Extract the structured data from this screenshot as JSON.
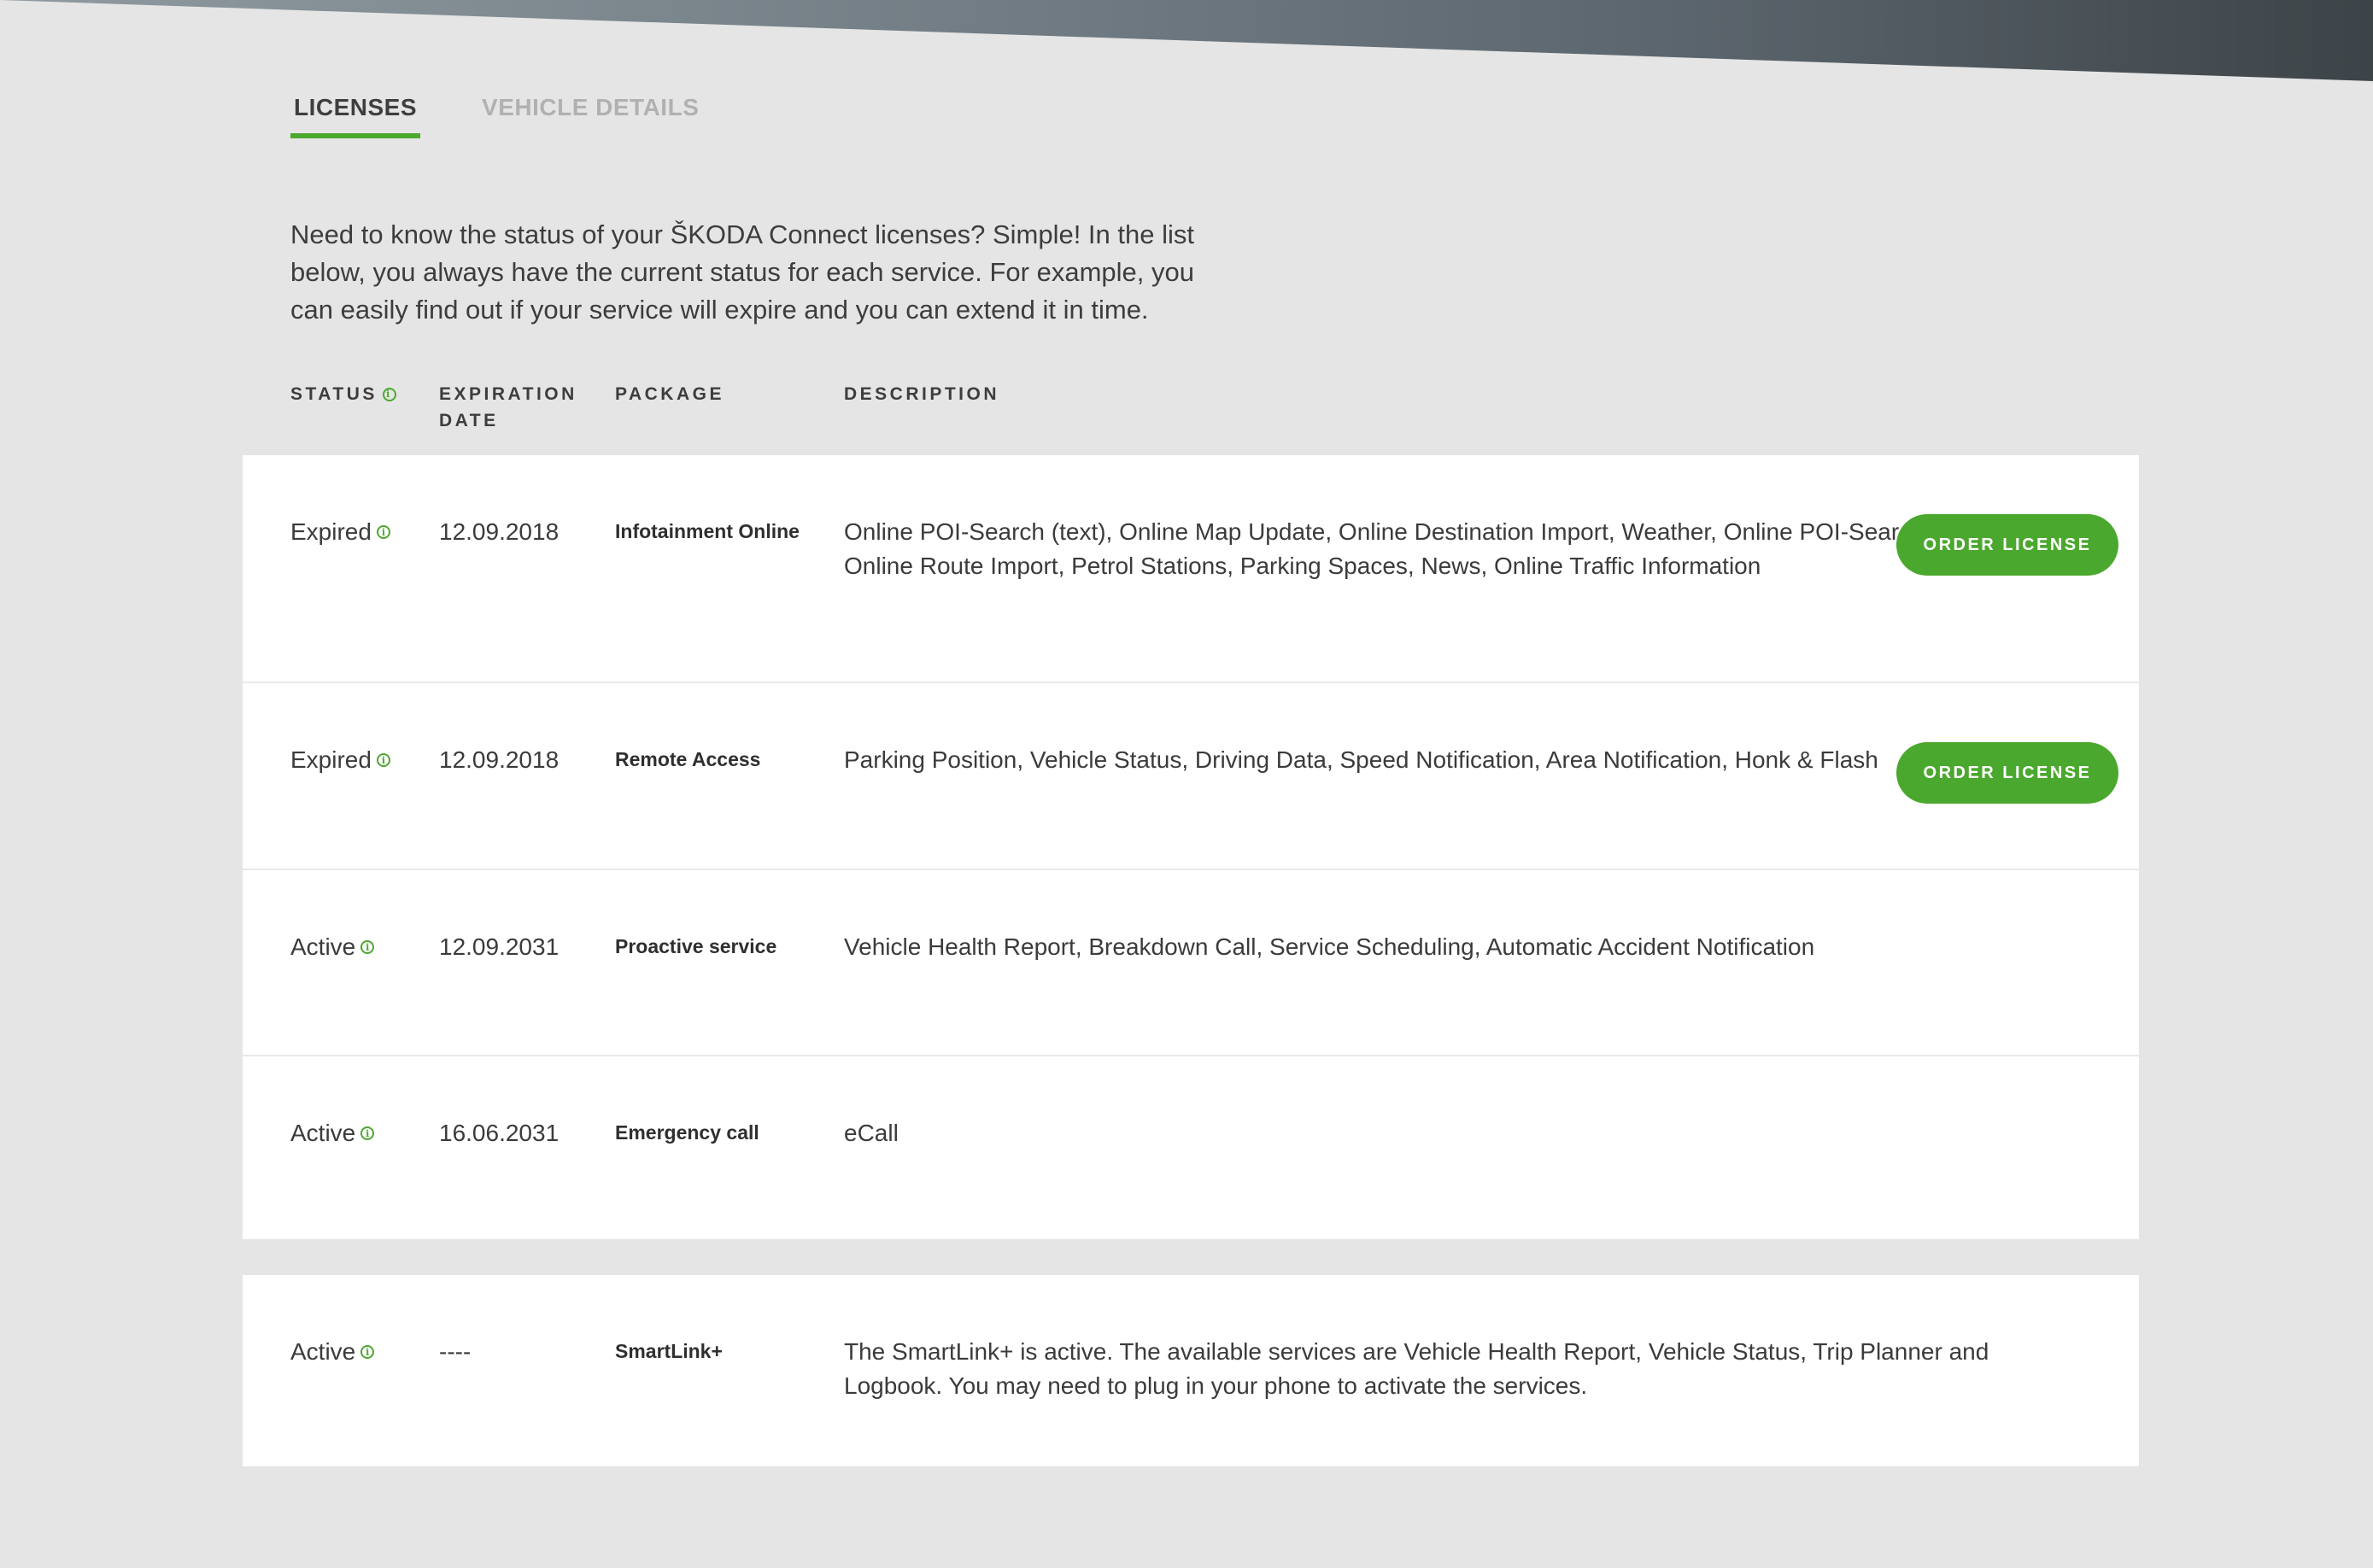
{
  "tabs": [
    {
      "label": "LICENSES",
      "active": true
    },
    {
      "label": "VEHICLE DETAILS",
      "active": false
    }
  ],
  "intro_text": "Need to know the status of your ŠKODA Connect licenses? Simple! In the list below, you always have the current status for each service. For example, you can easily find out if your service will expire and you can extend it in time.",
  "table_headers": {
    "status": "STATUS",
    "expiration": "EXPIRATION DATE",
    "package": "PACKAGE",
    "description": "DESCRIPTION"
  },
  "licenses": [
    {
      "status": "Expired",
      "expiration": "12.09.2018",
      "package": "Infotainment Online",
      "description": "Online POI-Search (text), Online Map Update, Online Destination Import, Weather, Online POI-Search (voice), Online Route Import, Petrol Stations, Parking Spaces, News, Online Traffic Information",
      "action": "ORDER LICENSE"
    },
    {
      "status": "Expired",
      "expiration": "12.09.2018",
      "package": "Remote Access",
      "description": "Parking Position, Vehicle Status, Driving Data, Speed Notification, Area Notification, Honk & Flash",
      "action": "ORDER LICENSE"
    },
    {
      "status": "Active",
      "expiration": "12.09.2031",
      "package": "Proactive service",
      "description": "Vehicle Health Report, Breakdown Call, Service Scheduling, Automatic Accident Notification"
    },
    {
      "status": "Active",
      "expiration": "16.06.2031",
      "package": "Emergency call",
      "description": "eCall"
    }
  ],
  "smartlink": {
    "status": "Active",
    "expiration": "----",
    "package": "SmartLink+",
    "description": "The SmartLink+ is active. The available services are Vehicle Health Report, Vehicle Status, Trip Planner and Logbook. You may need to plug in your phone to activate the services."
  },
  "colors": {
    "accent": "#4ba82e",
    "background": "#e5e5e5",
    "card": "#ffffff"
  },
  "icons": {
    "status_info": "info-circle-icon"
  }
}
